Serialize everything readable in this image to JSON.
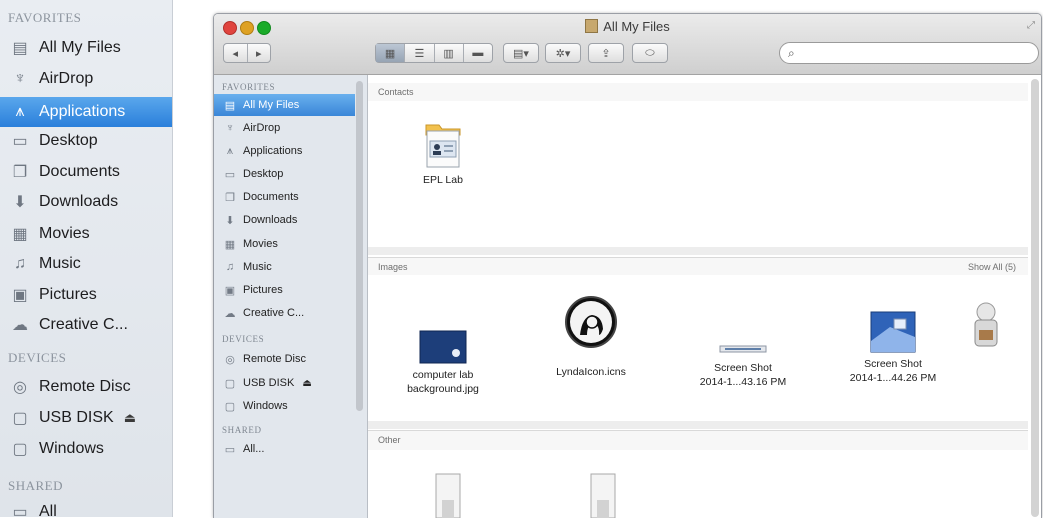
{
  "big_sidebar": {
    "favorites_label": "FAVORITES",
    "favorites": [
      {
        "label": "All My Files",
        "icon": "all-files-icon"
      },
      {
        "label": "AirDrop",
        "icon": "airdrop-icon"
      },
      {
        "label": "Applications",
        "icon": "applications-icon",
        "selected": true
      },
      {
        "label": "Desktop",
        "icon": "desktop-icon"
      },
      {
        "label": "Documents",
        "icon": "documents-icon"
      },
      {
        "label": "Downloads",
        "icon": "downloads-icon"
      },
      {
        "label": "Movies",
        "icon": "movies-icon"
      },
      {
        "label": "Music",
        "icon": "music-icon"
      },
      {
        "label": "Pictures",
        "icon": "pictures-icon"
      },
      {
        "label": "Creative C...",
        "icon": "creative-cloud-icon"
      }
    ],
    "devices_label": "DEVICES",
    "devices": [
      {
        "label": "Remote Disc",
        "icon": "disc-icon"
      },
      {
        "label": "USB DISK",
        "icon": "disk-icon",
        "eject": "⏏"
      },
      {
        "label": "Windows",
        "icon": "disk-icon"
      }
    ],
    "shared_label": "SHARED",
    "shared": [
      {
        "label": "All",
        "icon": "shared-icon"
      }
    ]
  },
  "window": {
    "title": "All My Files",
    "search": {
      "placeholder": "",
      "value": ""
    },
    "sidebar": {
      "favorites_label": "FAVORITES",
      "favorites": [
        {
          "label": "All My Files",
          "icon": "all-files-icon",
          "selected": true
        },
        {
          "label": "AirDrop",
          "icon": "airdrop-icon"
        },
        {
          "label": "Applications",
          "icon": "applications-icon"
        },
        {
          "label": "Desktop",
          "icon": "desktop-icon"
        },
        {
          "label": "Documents",
          "icon": "documents-icon"
        },
        {
          "label": "Downloads",
          "icon": "downloads-icon"
        },
        {
          "label": "Movies",
          "icon": "movies-icon"
        },
        {
          "label": "Music",
          "icon": "music-icon"
        },
        {
          "label": "Pictures",
          "icon": "pictures-icon"
        },
        {
          "label": "Creative C...",
          "icon": "creative-cloud-icon"
        }
      ],
      "devices_label": "DEVICES",
      "devices": [
        {
          "label": "Remote Disc",
          "icon": "disc-icon"
        },
        {
          "label": "USB DISK",
          "icon": "disk-icon",
          "eject": "⏏"
        },
        {
          "label": "Windows",
          "icon": "disk-icon"
        }
      ],
      "shared_label": "SHARED",
      "shared": [
        {
          "label": "All...",
          "icon": "shared-icon"
        }
      ]
    },
    "content": {
      "contacts_label": "Contacts",
      "contacts": [
        {
          "name": "EPL Lab"
        }
      ],
      "images_label": "Images",
      "images_show_all": "Show All (5)",
      "images": [
        {
          "line1": "computer lab",
          "line2": "background.jpg"
        },
        {
          "line1": "LyndaIcon.icns",
          "line2": ""
        },
        {
          "line1": "Screen Shot",
          "line2": "2014-1...43.16 PM"
        },
        {
          "line1": "Screen Shot",
          "line2": "2014-1...44.26 PM"
        }
      ],
      "other_label": "Other"
    }
  },
  "colors": {
    "selection": "#3a86d8",
    "close": "#e0443e",
    "minimize": "#dea123",
    "zoom": "#1aab29"
  }
}
